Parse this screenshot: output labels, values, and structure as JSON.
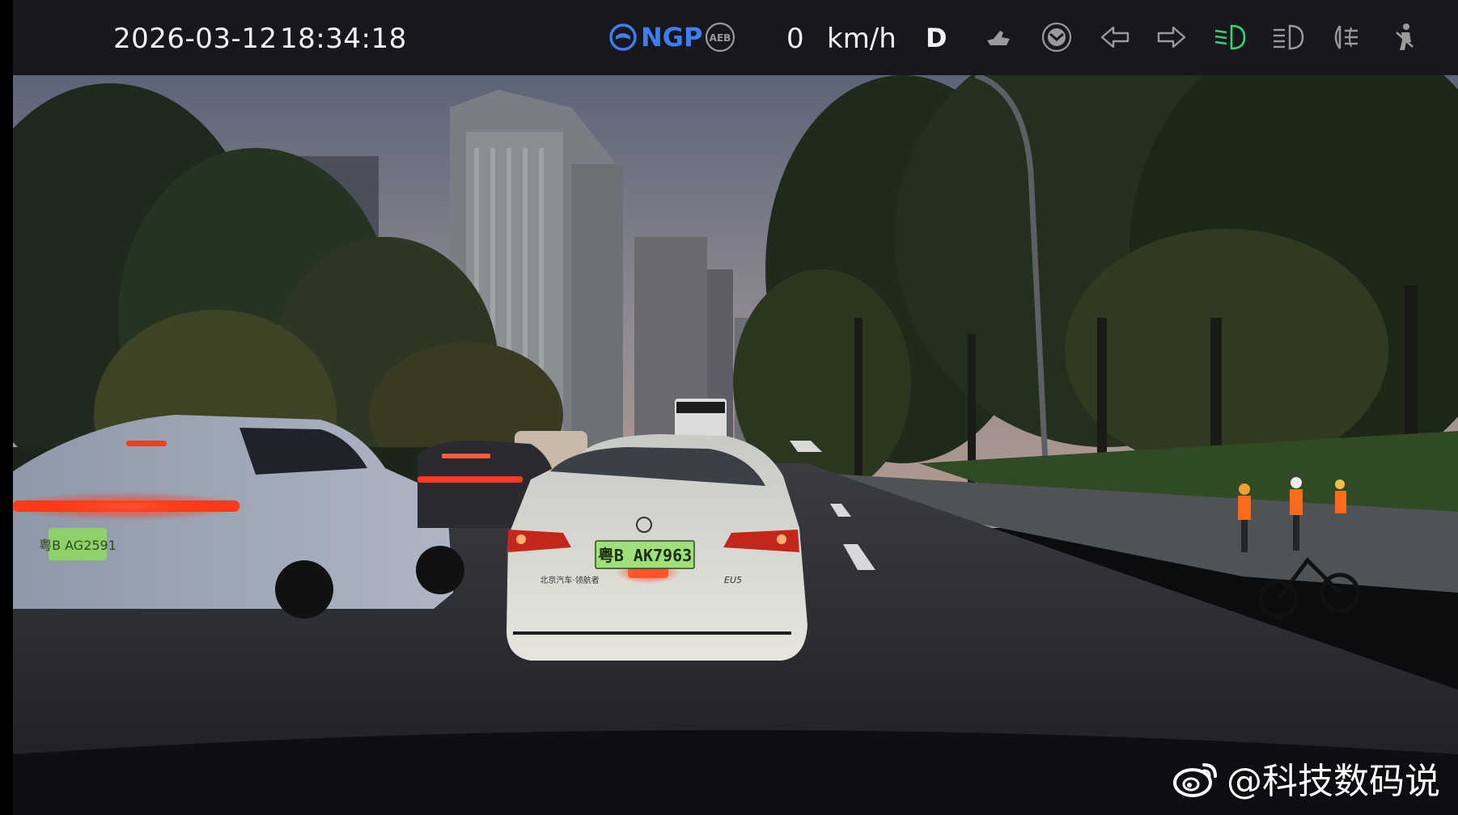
{
  "status_bar": {
    "date": "2026-03-12",
    "time": "18:34:18",
    "ngp_label": "NGP",
    "aeb_label": "AEB",
    "speed_value": "0",
    "speed_unit": "km/h",
    "gear": "D",
    "icons": [
      "ngp-icon",
      "aeb-icon",
      "wiper-icon",
      "seatbelt-icon",
      "turn-left-icon",
      "turn-right-icon",
      "low-beam-icon",
      "high-beam-icon",
      "fog-light-icon",
      "seatbelt-person-icon"
    ],
    "colors": {
      "ngp": "#3f7df3",
      "low_beam": "#3ccf7a",
      "icon_gray": "#9a9a9a"
    }
  },
  "scene": {
    "front_car_plate": "粤B AK7963",
    "front_car_badge": "北京汽车·领航者",
    "front_car_model": "EU5",
    "left_car_plate": "粤B AG2591"
  },
  "watermark": {
    "text": "@科技数码说",
    "icon": "weibo-icon"
  }
}
